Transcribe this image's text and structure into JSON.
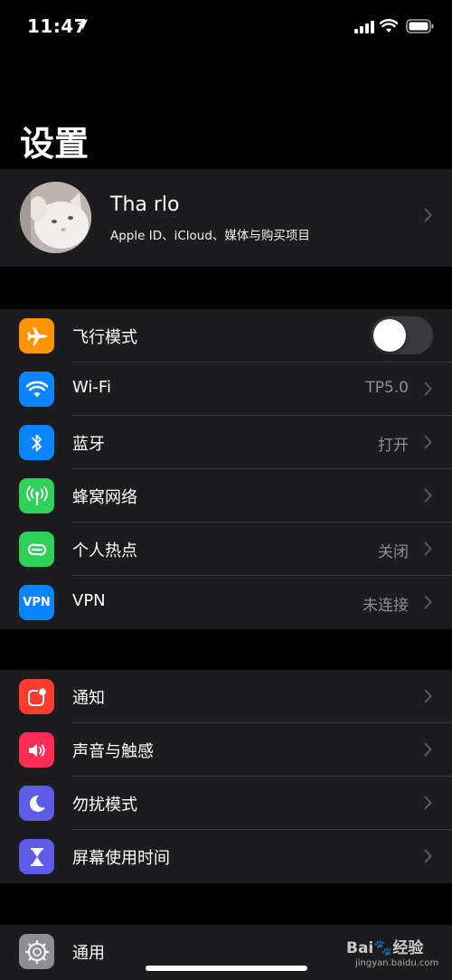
{
  "status_bar": {
    "time": "11:47",
    "icons": [
      "location-arrow-icon",
      "cellular-signal-icon",
      "wifi-icon",
      "battery-icon"
    ]
  },
  "page": {
    "title": "设置"
  },
  "profile": {
    "name": "Tha rlo",
    "subtitle": "Apple ID、iCloud、媒体与购买项目"
  },
  "connectivity": {
    "airplane": {
      "label": "飞行模式",
      "icon": "airplane-icon",
      "color": "#ff9500",
      "toggle_on": false
    },
    "wifi": {
      "label": "Wi-Fi",
      "value": "TP5.0",
      "icon": "wifi-icon",
      "color": "#0a84ff"
    },
    "bluetooth": {
      "label": "蓝牙",
      "value": "打开",
      "icon": "bluetooth-icon",
      "color": "#0a84ff"
    },
    "cellular": {
      "label": "蜂窝网络",
      "icon": "cellular-antenna-icon",
      "color": "#30d158"
    },
    "hotspot": {
      "label": "个人热点",
      "value": "关闭",
      "icon": "hotspot-link-icon",
      "color": "#30d158"
    },
    "vpn": {
      "label": "VPN",
      "value": "未连接",
      "icon_text": "VPN",
      "color": "#0a84ff"
    }
  },
  "alerts": {
    "notifications": {
      "label": "通知",
      "icon": "notifications-icon",
      "color": "#ff3b30"
    },
    "sounds": {
      "label": "声音与触感",
      "icon": "speaker-icon",
      "color": "#ff2d55"
    },
    "dnd": {
      "label": "勿扰模式",
      "icon": "moon-icon",
      "color": "#5e5ce6"
    },
    "screen_time": {
      "label": "屏幕使用时间",
      "icon": "hourglass-icon",
      "color": "#5e5ce6"
    }
  },
  "general": {
    "general": {
      "label": "通用",
      "icon": "gear-icon",
      "color": "#8e8e93"
    }
  },
  "watermark": {
    "logo": "Bai🐾经验",
    "url": "jingyan.baidu.com"
  }
}
